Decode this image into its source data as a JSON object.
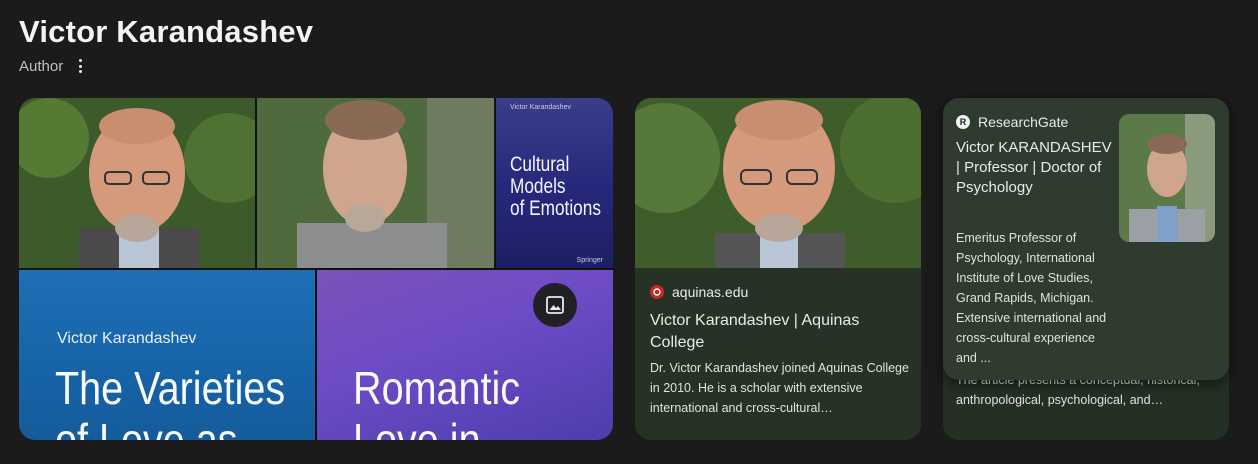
{
  "header": {
    "title": "Victor Karandashev",
    "subtitle": "Author"
  },
  "collage": {
    "book1": {
      "author": "Victor Karandashev",
      "title": "Cultural\nModels\nof Emotions",
      "publisher": "Springer"
    },
    "book2": {
      "author": "Victor Karandashev",
      "title": "The Varieties\nof Love as"
    },
    "book3": {
      "title": "Romantic\nLove in"
    }
  },
  "card1": {
    "source": "aquinas.edu",
    "title": "Victor Karandashev | Aquinas College",
    "desc": "Dr. Victor Karandashev joined Aquinas College in 2010. He is a scholar with extensive international and cross-cultural…"
  },
  "card2": {
    "desc_behind": "The article presents a conceptual, historical, anthropological, psychological, and…"
  },
  "popover": {
    "source": "ResearchGate",
    "title": "Victor KARANDASHEV | Professor | Doctor of Psychology",
    "desc": "Emeritus Professor of Psychology, International Institute of Love Studies, Grand Rapids, Michigan. Extensive international and cross-cultural experience and ..."
  },
  "colors": {
    "background": "#1b1b1b",
    "card": "#273227",
    "popover": "#2f3b2f"
  },
  "icons": {
    "more": "more-vert-icon",
    "image": "image-icon",
    "aquinas": "aquinas-favicon",
    "researchgate": "researchgate-favicon"
  }
}
